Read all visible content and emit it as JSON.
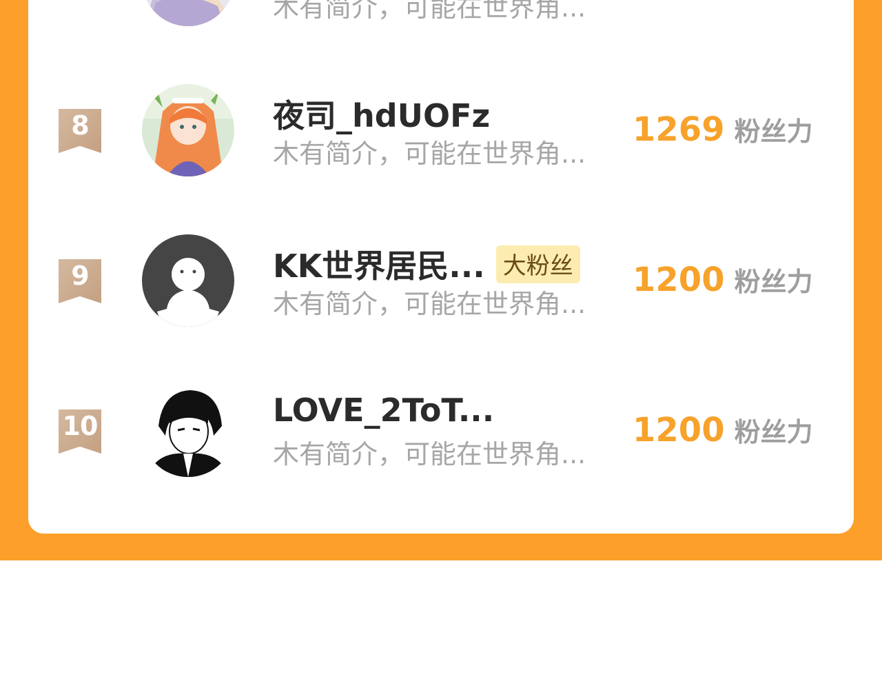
{
  "partial_row": {
    "intro": "木有简介，可能在世界角..."
  },
  "rows": [
    {
      "rank": "8",
      "name": "夜司_hdUOFz",
      "tag": "",
      "intro": "木有简介，可能在世界角...",
      "score": "1269",
      "unit": "粉丝力",
      "avatar": "anime-girl-avatar"
    },
    {
      "rank": "9",
      "name": "KK世界居民...",
      "tag": "大粉丝",
      "intro": "木有简介，可能在世界角...",
      "score": "1200",
      "unit": "粉丝力",
      "avatar": "default-ghost-avatar"
    },
    {
      "rank": "10",
      "name": "LOVE_2ToT...",
      "tag": "",
      "intro": "木有简介，可能在世界角...",
      "score": "1200",
      "unit": "粉丝力",
      "avatar": "manga-boy-avatar"
    }
  ],
  "colors": {
    "accent_orange": "#fd9f2b",
    "score_orange": "#f7a22b",
    "rank_badge": "#c9a889",
    "tag_bg": "#fcecb0"
  }
}
